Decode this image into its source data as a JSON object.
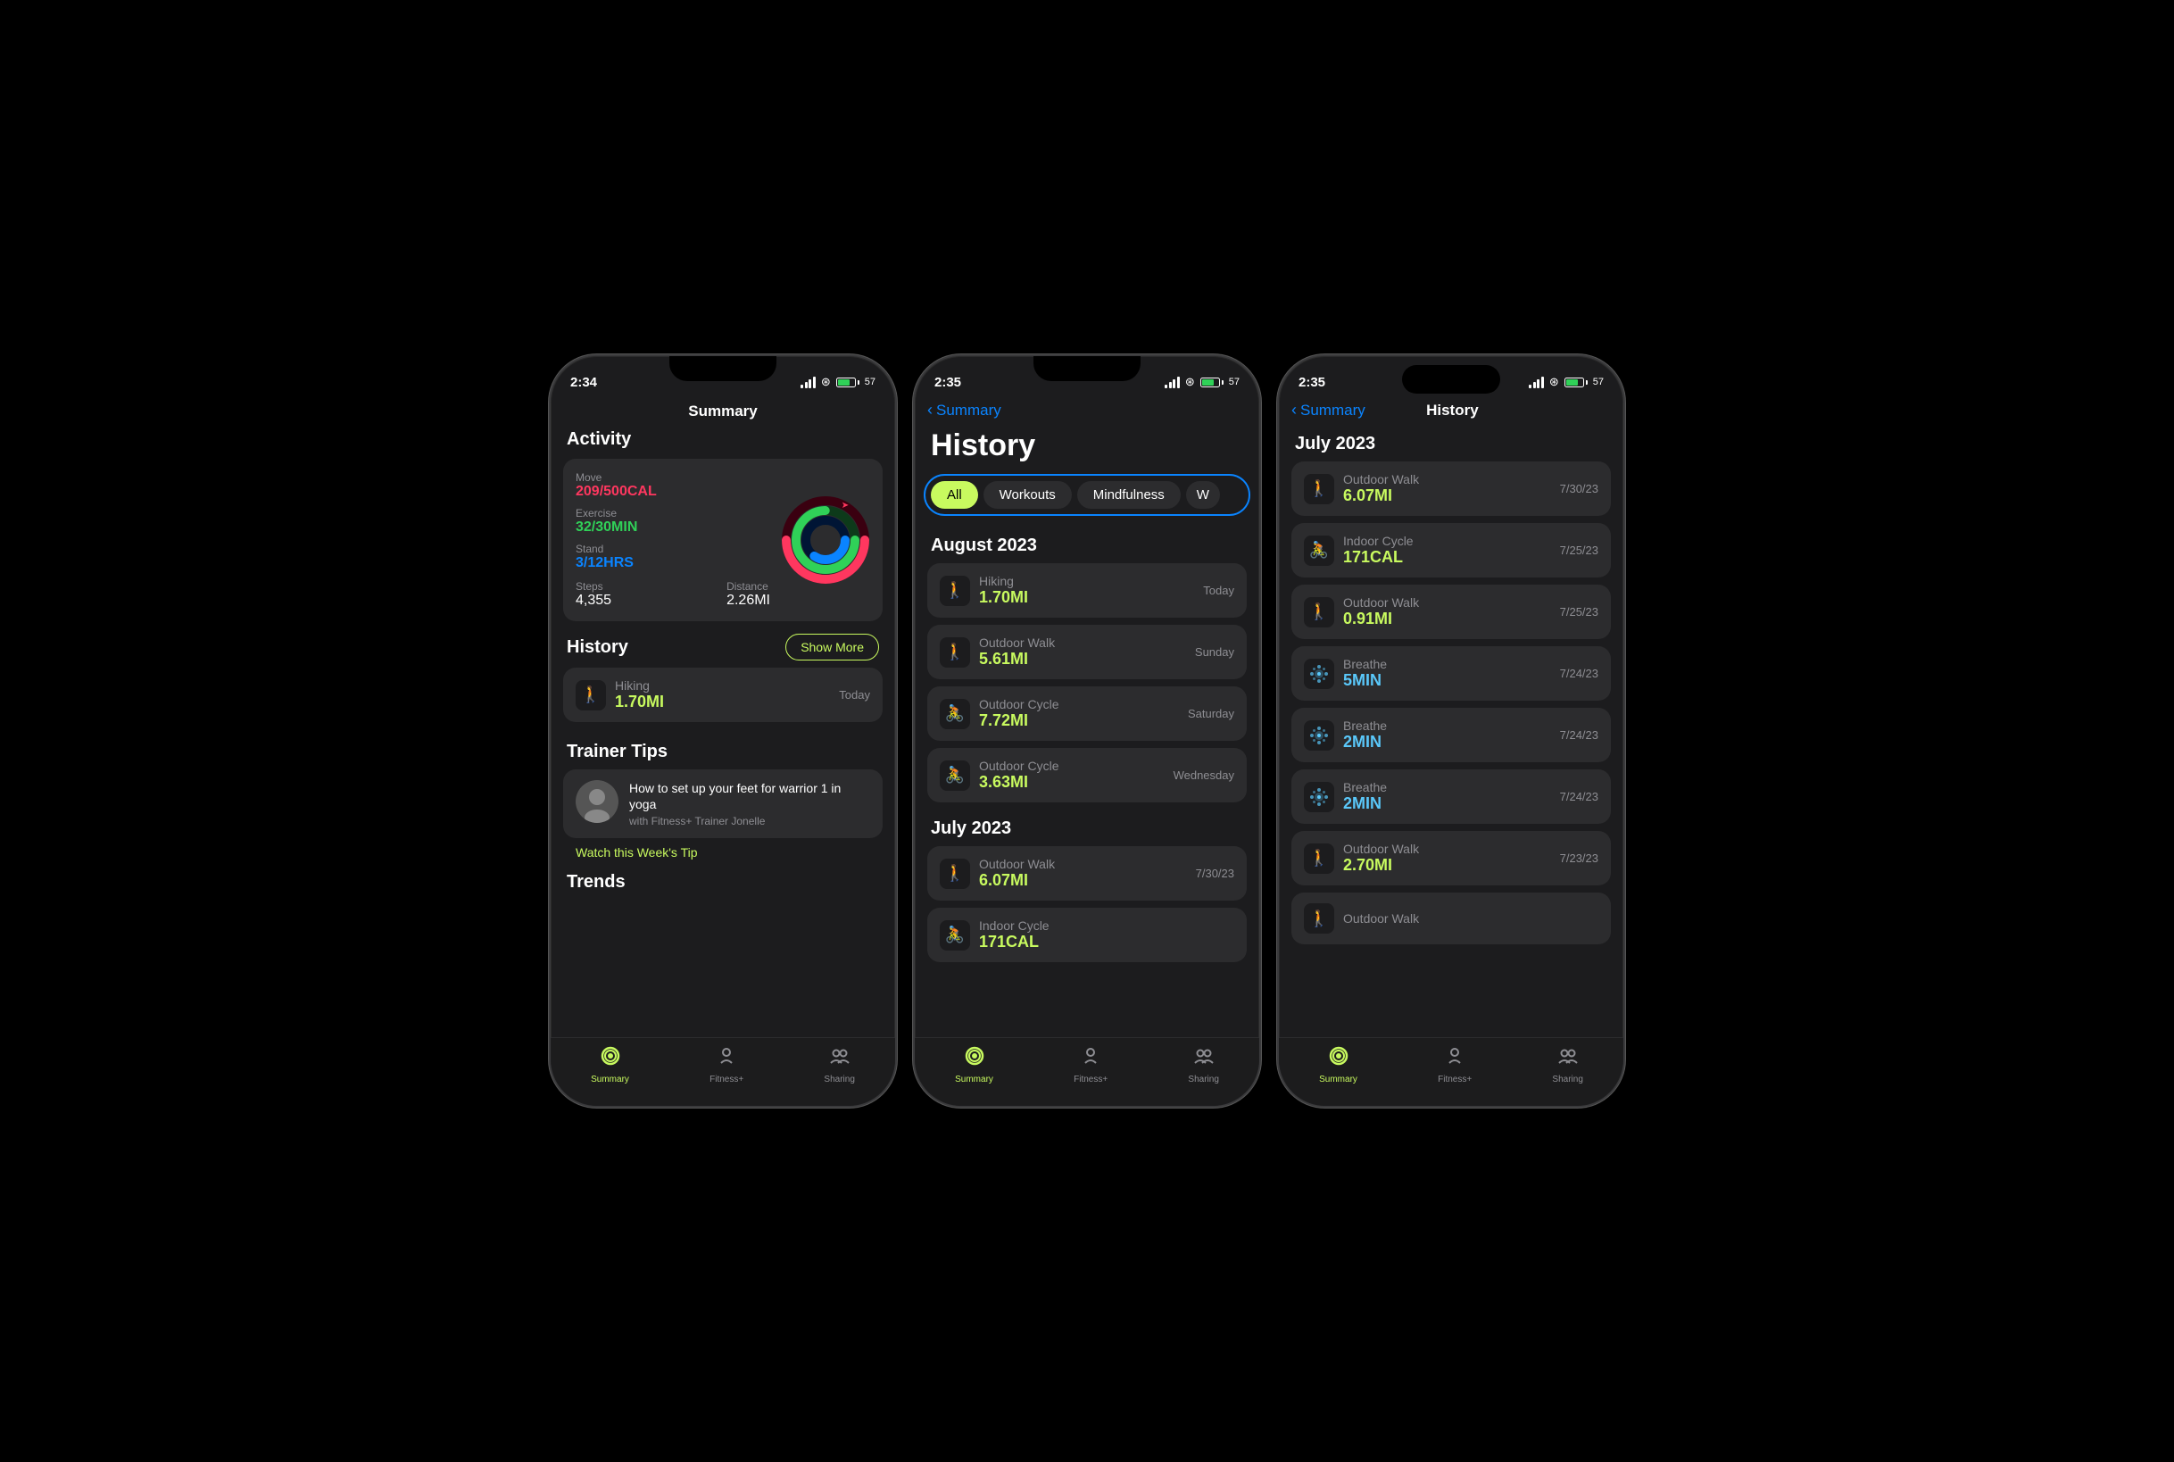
{
  "phone1": {
    "statusBar": {
      "time": "2:34",
      "battery": "57"
    },
    "navTitle": "Summary",
    "activity": {
      "sectionLabel": "Activity",
      "move": {
        "label": "Move",
        "value": "209/500CAL"
      },
      "exercise": {
        "label": "Exercise",
        "value": "32/30MIN"
      },
      "stand": {
        "label": "Stand",
        "value": "3/12HRS"
      },
      "steps": {
        "label": "Steps",
        "value": "4,355"
      },
      "distance": {
        "label": "Distance",
        "value": "2.26MI"
      }
    },
    "history": {
      "label": "History",
      "showMore": "Show More",
      "items": [
        {
          "name": "Hiking",
          "value": "1.70MI",
          "date": "Today",
          "icon": "🚶",
          "type": "hike"
        }
      ]
    },
    "trainerTips": {
      "label": "Trainer Tips",
      "title": "How to set up your feet for warrior 1 in yoga",
      "sub": "with Fitness+ Trainer Jonelle",
      "link": "Watch this Week's Tip"
    },
    "tabBar": {
      "items": [
        {
          "label": "Summary",
          "active": true
        },
        {
          "label": "Fitness+",
          "active": false
        },
        {
          "label": "Sharing",
          "active": false
        }
      ]
    }
  },
  "phone2": {
    "statusBar": {
      "time": "2:35",
      "battery": "57"
    },
    "back": "Summary",
    "title": "History",
    "filters": [
      "All",
      "Workouts",
      "Mindfulness",
      "W"
    ],
    "activeFilter": "All",
    "sections": [
      {
        "month": "August 2023",
        "items": [
          {
            "name": "Hiking",
            "value": "1.70MI",
            "date": "Today",
            "type": "hike"
          },
          {
            "name": "Outdoor Walk",
            "value": "5.61MI",
            "date": "Sunday",
            "type": "walk"
          },
          {
            "name": "Outdoor Cycle",
            "value": "7.72MI",
            "date": "Saturday",
            "type": "cycle"
          },
          {
            "name": "Outdoor Cycle",
            "value": "3.63MI",
            "date": "Wednesday",
            "type": "cycle"
          }
        ]
      },
      {
        "month": "July 2023",
        "items": [
          {
            "name": "Outdoor Walk",
            "value": "6.07MI",
            "date": "7/30/23",
            "type": "walk"
          },
          {
            "name": "Indoor Cycle",
            "value": "171CAL",
            "date": "",
            "type": "cycle"
          }
        ]
      }
    ],
    "tabBar": {
      "items": [
        {
          "label": "Summary",
          "active": true
        },
        {
          "label": "Fitness+",
          "active": false
        },
        {
          "label": "Sharing",
          "active": false
        }
      ]
    }
  },
  "phone3": {
    "statusBar": {
      "time": "2:35",
      "battery": "57"
    },
    "back": "Summary",
    "title": "History",
    "sections": [
      {
        "month": "July 2023",
        "items": [
          {
            "name": "Outdoor Walk",
            "value": "6.07MI",
            "date": "7/30/23",
            "type": "walk"
          },
          {
            "name": "Indoor Cycle",
            "value": "171CAL",
            "date": "7/25/23",
            "type": "cycle"
          },
          {
            "name": "Outdoor Walk",
            "value": "0.91MI",
            "date": "7/25/23",
            "type": "walk"
          },
          {
            "name": "Breathe",
            "value": "5MIN",
            "date": "7/24/23",
            "type": "breathe"
          },
          {
            "name": "Breathe",
            "value": "2MIN",
            "date": "7/24/23",
            "type": "breathe"
          },
          {
            "name": "Breathe",
            "value": "2MIN",
            "date": "7/24/23",
            "type": "breathe"
          },
          {
            "name": "Outdoor Walk",
            "value": "2.70MI",
            "date": "7/23/23",
            "type": "walk"
          },
          {
            "name": "Outdoor Walk",
            "value": "",
            "date": "",
            "type": "walk"
          }
        ]
      }
    ],
    "tabBar": {
      "items": [
        {
          "label": "Summary",
          "active": true
        },
        {
          "label": "Fitness+",
          "active": false
        },
        {
          "label": "Sharing",
          "active": false
        }
      ]
    }
  },
  "colors": {
    "accent": "#c8fa5f",
    "red": "#ff375f",
    "green": "#30d158",
    "blue": "#0a84ff",
    "breathe": "#5ac8fa"
  }
}
